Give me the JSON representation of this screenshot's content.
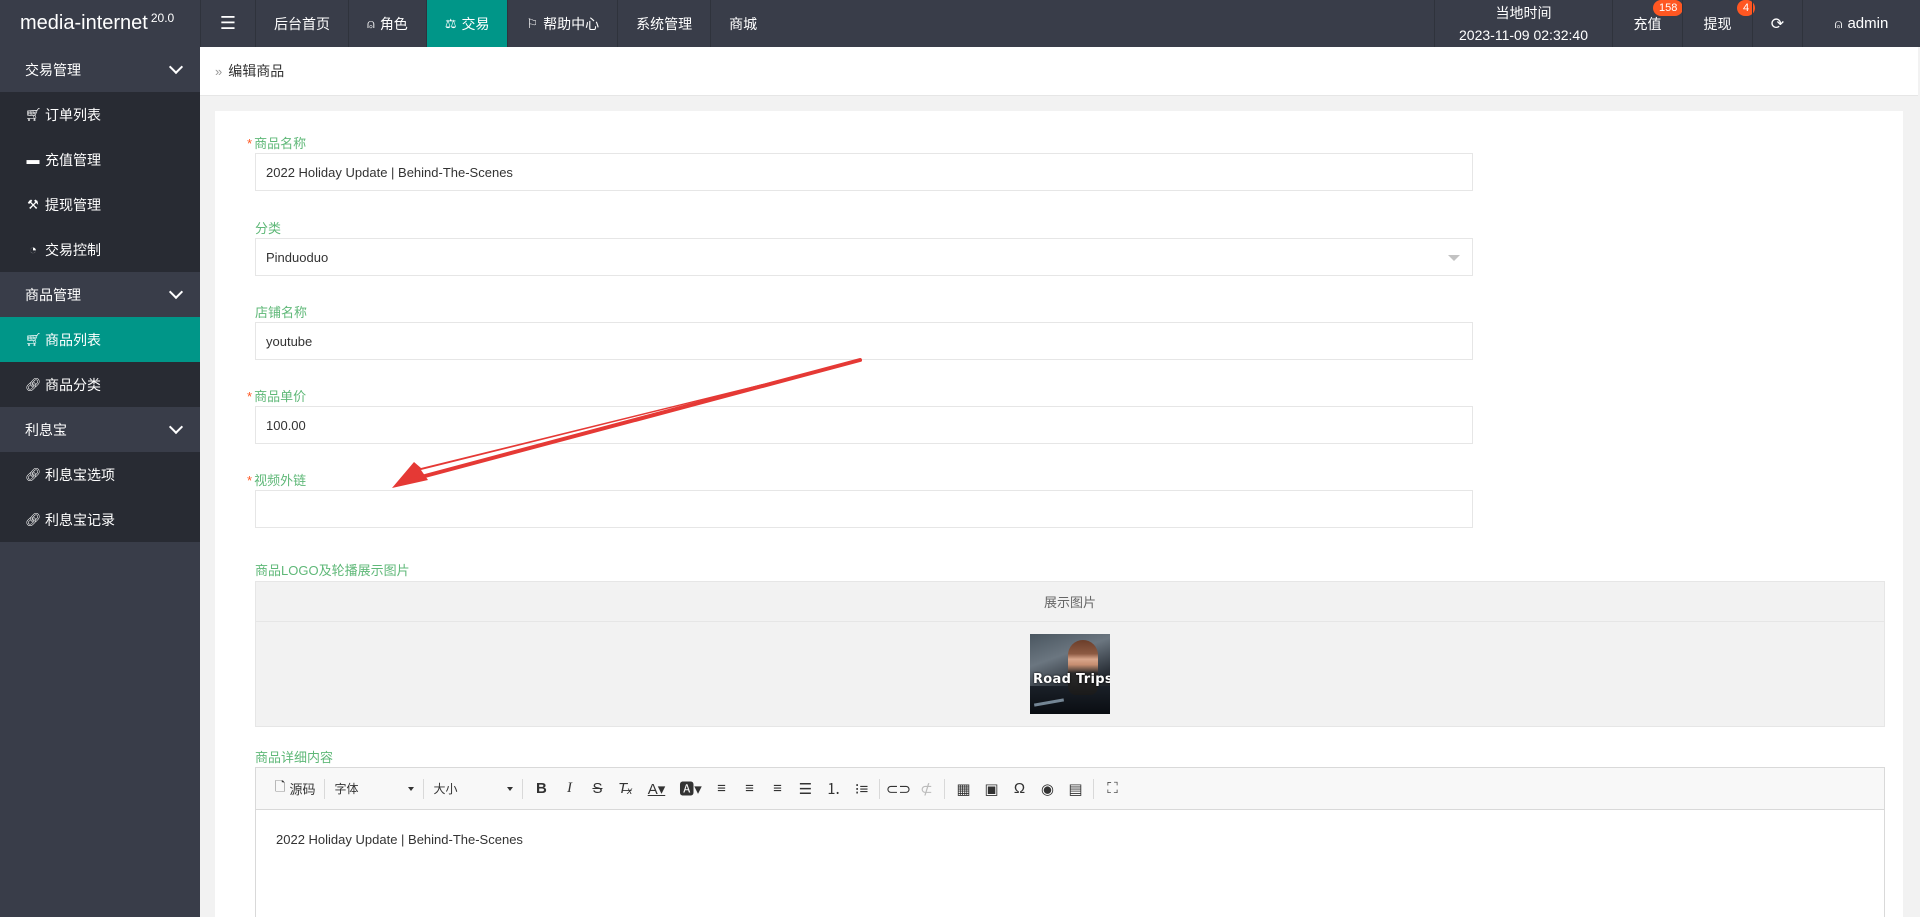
{
  "app": {
    "title": "media-internet",
    "version": "20.0"
  },
  "topnav": {
    "menu_icon": "hamburger-icon",
    "items": [
      {
        "label": "后台首页",
        "icon": ""
      },
      {
        "label": "角色",
        "icon": "user-icon"
      },
      {
        "label": "交易",
        "icon": "scale-icon",
        "active": true
      },
      {
        "label": "帮助中心",
        "icon": "flag-icon"
      },
      {
        "label": "系统管理",
        "icon": ""
      },
      {
        "label": "商城",
        "icon": ""
      }
    ]
  },
  "topright": {
    "time_label": "当地时间",
    "time_value": "2023-11-09 02:32:40",
    "recharge": {
      "label": "充值",
      "badge": "158"
    },
    "withdraw": {
      "label": "提现",
      "badge": "4"
    },
    "refresh_icon": "refresh-icon",
    "user": "admin"
  },
  "sidebar": {
    "groups": [
      {
        "label": "交易管理",
        "items": [
          {
            "label": "订单列表",
            "icon": "cart-icon"
          },
          {
            "label": "充值管理",
            "icon": "chat-icon"
          },
          {
            "label": "提现管理",
            "icon": "hammer-icon"
          },
          {
            "label": "交易控制",
            "icon": "dashboard-icon"
          }
        ]
      },
      {
        "label": "商品管理",
        "items": [
          {
            "label": "商品列表",
            "icon": "cart-icon",
            "active": true
          },
          {
            "label": "商品分类",
            "icon": "link-icon"
          }
        ]
      },
      {
        "label": "利息宝",
        "items": [
          {
            "label": "利息宝选项",
            "icon": "link-icon"
          },
          {
            "label": "利息宝记录",
            "icon": "link-icon"
          }
        ]
      }
    ]
  },
  "breadcrumb": {
    "label": "编辑商品"
  },
  "form": {
    "name": {
      "label": "商品名称",
      "required": true,
      "value": "2022 Holiday Update | Behind-The-Scenes"
    },
    "category": {
      "label": "分类",
      "value": "Pinduoduo"
    },
    "shop": {
      "label": "店铺名称",
      "value": "youtube"
    },
    "price": {
      "label": "商品单价",
      "required": true,
      "value": "100.00"
    },
    "video": {
      "label": "视频外链",
      "required": true,
      "value": ""
    },
    "images": {
      "label": "商品LOGO及轮播展示图片",
      "header": "展示图片",
      "thumb_text": "Road Trips"
    },
    "detail": {
      "label": "商品详细内容",
      "toolbar": {
        "source": "源码",
        "font": "字体",
        "size": "大小"
      },
      "content": "2022 Holiday Update | Behind-The-Scenes"
    }
  },
  "colors": {
    "accent": "#009688",
    "topbar": "#393d49",
    "label_green": "#5fb878",
    "badge": "#ff5722",
    "arrow": "#e53935"
  }
}
